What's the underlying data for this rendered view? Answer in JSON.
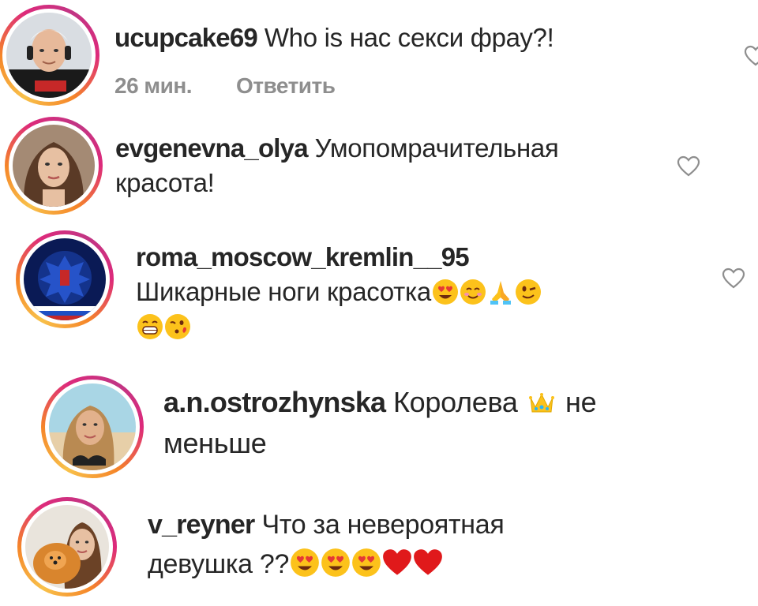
{
  "comments": [
    {
      "username": "ucupcake69",
      "text": "Who is нас секси фрау?!",
      "time": "26 мин.",
      "reply": "Ответить",
      "avatar": "avatar-man-headphones"
    },
    {
      "username": "evgenevna_olya",
      "text_line1": "Умопомрачительная",
      "text_line2": "красота!",
      "avatar": "avatar-woman-portrait"
    },
    {
      "username": "roma_moscow_kremlin__95",
      "text_line1": "Шикарные ноги красотка",
      "emoji_line1": [
        "heart-eyes",
        "smiling",
        "praying-hands",
        "wink"
      ],
      "emoji_line2": [
        "grinning",
        "kissing-heart"
      ],
      "avatar": "avatar-coat-of-arms"
    },
    {
      "username": "a.n.ostrozhynska",
      "text_line1": "Королева",
      "emoji_inline": "crown",
      "text_after": "не",
      "text_line2": "меньше",
      "avatar": "avatar-woman-beach"
    },
    {
      "username": "v_reyner",
      "text_line1": "Что за невероятная",
      "text_line2": "девушка ??",
      "emoji_line2": [
        "heart-eyes",
        "heart-eyes",
        "heart-eyes",
        "red-heart",
        "red-heart"
      ],
      "avatar": "avatar-woman-dog"
    }
  ],
  "colors": {
    "text": "#262626",
    "meta": "#8e8e8e",
    "story_ring_start": "#f58529",
    "story_ring_end": "#dd2a7b",
    "heart_outline": "#8e8e8e"
  },
  "icons": {
    "like": "heart-outline-icon"
  }
}
